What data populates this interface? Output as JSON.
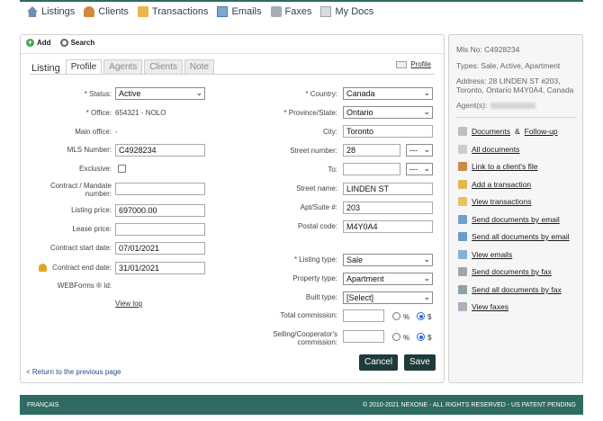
{
  "topnav": [
    {
      "label": "Listings",
      "icon": "house-icon"
    },
    {
      "label": "Clients",
      "icon": "person-icon"
    },
    {
      "label": "Transactions",
      "icon": "folder-icon"
    },
    {
      "label": "Emails",
      "icon": "mail-icon"
    },
    {
      "label": "Faxes",
      "icon": "fax-icon"
    },
    {
      "label": "My Docs",
      "icon": "doc-icon"
    }
  ],
  "toolbar": {
    "add_label": "Add",
    "search_label": "Search"
  },
  "tabs": {
    "listing": "Listing",
    "profile": "Profile",
    "agents": "Agents",
    "clients": "Clients",
    "note": "Note",
    "active": "Profile"
  },
  "profile_link": "Profile",
  "left_form": {
    "status_label": "* Status:",
    "status_value": "Active",
    "office_label": "* Office:",
    "office_value": "654321 - NOLO",
    "main_office_label": "Main office:",
    "main_office_value": "-",
    "mls_label": "MLS Number:",
    "mls_value": "C4928234",
    "exclusive_label": "Exclusive:",
    "contract_label_1": "Contract / Mandate",
    "contract_label_2": "number:",
    "listing_price_label": "Listing price:",
    "listing_price_value": "697000.00",
    "lease_price_label": "Lease price:",
    "contract_start_label": "Contract start date:",
    "contract_start_value": "07/01/2021",
    "contract_end_label": "Contract end date:",
    "contract_end_value": "31/01/2021",
    "webforms_label": "WEBForms ® Id:",
    "view_log": "View log"
  },
  "right_form": {
    "country_label": "* Country:",
    "country_value": "Canada",
    "province_label": "* Province/State:",
    "province_value": "Ontario",
    "city_label": "City:",
    "city_value": "Toronto",
    "street_number_label": "Street number:",
    "street_number_value": "28",
    "dash_value": "---",
    "to_label": "To:",
    "street_name_label": "Street name:",
    "street_name_value": "LINDEN ST",
    "apt_label": "Apt/Suite #:",
    "apt_value": "203",
    "postal_label": "Postal code:",
    "postal_value": "M4Y0A4",
    "listing_type_label": "* Listing type:",
    "listing_type_value": "Sale",
    "property_type_label": "Property type:",
    "property_type_value": "Apartment",
    "built_type_label": "Built type:",
    "built_type_value": "[Select]",
    "total_commission_label": "Total commission:",
    "selling_label_1": "Selling/Cooperator's",
    "selling_label_2": "commission:",
    "percent": "%",
    "dollar": "$"
  },
  "buttons": {
    "cancel": "Cancel",
    "save": "Save"
  },
  "back_link": "< Return to the previous page",
  "summary": {
    "mls_line": "Mls No:   C4928234",
    "types_line": "Types:  Sale, Active, Apartment",
    "address_line_1": "Address:  28 LINDEN ST #203,",
    "address_line_2": "Toronto, Ontario M4Y0A4, Canada",
    "agents_label": "Agent(s):"
  },
  "actions": [
    {
      "text": "Documents",
      "text2": " & ",
      "text3": "Follow-up",
      "icon": "documents-icon",
      "color": "#b9c0c8"
    },
    {
      "text": "All documents",
      "icon": "all-documents-icon",
      "color": "#c9ced4"
    },
    {
      "text": "Link to a client's file",
      "icon": "link-client-icon",
      "color": "#c98a4a"
    },
    {
      "text": "Add a transaction",
      "icon": "add-transaction-icon",
      "color": "#e5b84d"
    },
    {
      "text": "View transactions",
      "icon": "view-transactions-icon",
      "color": "#e9c25f"
    },
    {
      "text": "Send documents by email",
      "icon": "send-email-icon",
      "color": "#6fa0d0"
    },
    {
      "text": "Send all documents by email",
      "icon": "send-all-email-icon",
      "color": "#6a9bcc"
    },
    {
      "text": "View emails",
      "icon": "view-emails-icon",
      "color": "#89aed3"
    },
    {
      "text": "Send documents by fax",
      "icon": "send-fax-icon",
      "color": "#9ea7b1"
    },
    {
      "text": "Send all documents by fax",
      "icon": "send-all-fax-icon",
      "color": "#8ea0a8"
    },
    {
      "text": "View faxes",
      "icon": "view-faxes-icon",
      "color": "#a9b2bb"
    }
  ],
  "footer": {
    "language": "FRANÇAIS",
    "copyright": "© 2010-2021 NEXONE - ALL RIGHTS RESERVED - US PATENT PENDING"
  }
}
